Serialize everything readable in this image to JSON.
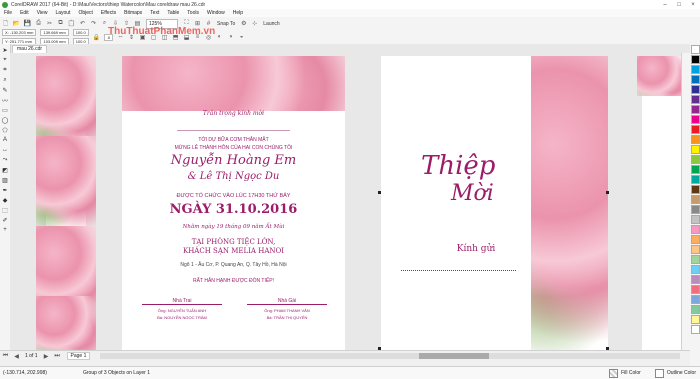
{
  "window": {
    "title": "CorelDRAW 2017 (64-Bit) - D:\\Mau\\Vectors\\thiep Watercolor\\Mau coreldraw mau 26.cdr",
    "watermark": "ThuThuatPhanMem.vn"
  },
  "menu": [
    "File",
    "Edit",
    "View",
    "Layout",
    "Object",
    "Effects",
    "Bitmaps",
    "Text",
    "Table",
    "Tools",
    "Window",
    "Help"
  ],
  "toolbar": {
    "zoom": "125%",
    "snap_label": "Snap To",
    "launch_label": "Launch"
  },
  "propbar": {
    "x": "X: -130.203 mm",
    "y": "Y: 251.771 mm",
    "w": "139.669 mm",
    "h": "103.009 mm",
    "sx": "100.0",
    "sy": "100.0",
    "angle": ".0"
  },
  "tabs": [
    {
      "label": "mau 26.cdr"
    }
  ],
  "invitation": {
    "greeting": "Trân trọng kính mời",
    "line1": "TỚI DỰ BỮA CƠM THÂN MẬT",
    "line2": "MỪNG LỄ THÀNH HÔN CỦA HAI CON CHÚNG TÔI",
    "groom": "Nguyễn Hoàng Em",
    "bride": "& Lê Thị Ngọc Du",
    "time_line": "ĐƯỢC TỔ CHỨC VÀO LÚC 17H30 THỨ BẢY",
    "date": "NGÀY 31.10.2016",
    "lunar": "Nhằm ngày 19 tháng 09 năm Ất Mùi",
    "venue1": "TẠI PHÒNG TIỆC LỚN,",
    "venue2": "KHÁCH SẠN MELIA HANOI",
    "address": "Ngõ 1 - Âu Cơ, P. Quang An, Q. Tây Hồ, Hà Nội",
    "welcome": "RẤT HÂN HẠNH ĐƯỢC ĐÓN TIẾP!",
    "groom_side_title": "Nhà Trai",
    "groom_father": "Ông: NGUYỄN TUẤN ANH",
    "groom_mother": "Bà: NGUYỄN NGỌC TRÂM",
    "bride_side_title": "Nhà Gái",
    "bride_father": "Ông: PHẠM THANH VĂN",
    "bride_mother": "Bà: TRẦN THỊ QUYÊN"
  },
  "card": {
    "title1": "Thiệp",
    "title2": "Mời",
    "kinh_gui": "Kính gửi"
  },
  "bottom": {
    "page_label": "Page 1",
    "page_info": "1 of 1"
  },
  "status": {
    "coords": "(-130.714, 202.998)",
    "object_info": "Group of 3 Objects on Layer 1",
    "fill_label": "Fill Color",
    "outline_label": "Outline Color"
  },
  "colors": {
    "accent": "#9b1d6a",
    "pink": "#ec93ae",
    "leaf": "#7aa75a"
  },
  "palette": [
    "#ffffff",
    "#000000",
    "#00a0e3",
    "#0072bc",
    "#2e3192",
    "#662d91",
    "#92278f",
    "#ec008c",
    "#ed1c24",
    "#f7941d",
    "#fff200",
    "#8dc63f",
    "#00a651",
    "#00a99d",
    "#603913",
    "#c69c6d",
    "#898989",
    "#c2c2c2",
    "#f49ac2",
    "#fbad60",
    "#fdc689",
    "#a3d39c",
    "#6dcff6",
    "#bd8cbf",
    "#f26d7d",
    "#7da7d9",
    "#82ca9c",
    "#fff799",
    "#ffffff"
  ]
}
